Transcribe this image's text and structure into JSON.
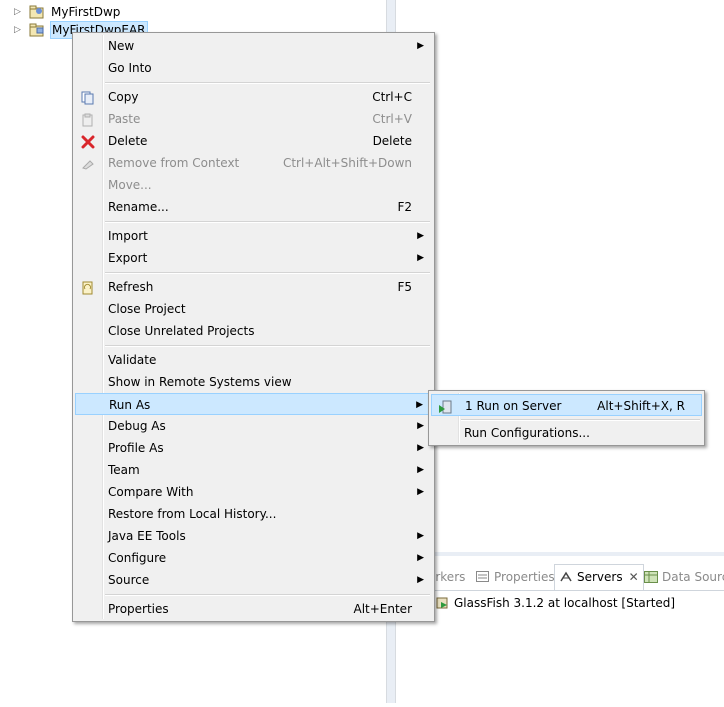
{
  "explorer": {
    "projects": [
      {
        "label": "MyFirstDwp",
        "selected": false
      },
      {
        "label": "MyFirstDwpEAR",
        "selected": true
      }
    ]
  },
  "context_menu": {
    "items": [
      {
        "label": "New",
        "accel": "",
        "submenu": true
      },
      {
        "label": "Go Into",
        "accel": ""
      },
      {
        "label": "Copy",
        "accel": "Ctrl+C",
        "icon": "copy-icon"
      },
      {
        "label": "Paste",
        "accel": "Ctrl+V",
        "icon": "paste-icon",
        "disabled": true
      },
      {
        "label": "Delete",
        "accel": "Delete",
        "icon": "delete-icon"
      },
      {
        "label": "Remove from Context",
        "accel": "Ctrl+Alt+Shift+Down",
        "icon": "remove-context-icon",
        "disabled": true
      },
      {
        "label": "Move...",
        "accel": "",
        "disabled": true
      },
      {
        "label": "Rename...",
        "accel": "F2"
      },
      {
        "label": "Import",
        "accel": "",
        "submenu": true
      },
      {
        "label": "Export",
        "accel": "",
        "submenu": true
      },
      {
        "label": "Refresh",
        "accel": "F5",
        "icon": "refresh-icon"
      },
      {
        "label": "Close Project",
        "accel": ""
      },
      {
        "label": "Close Unrelated Projects",
        "accel": ""
      },
      {
        "label": "Validate",
        "accel": ""
      },
      {
        "label": "Show in Remote Systems view",
        "accel": ""
      },
      {
        "label": "Run As",
        "accel": "",
        "submenu": true,
        "highlighted": true
      },
      {
        "label": "Debug As",
        "accel": "",
        "submenu": true
      },
      {
        "label": "Profile As",
        "accel": "",
        "submenu": true
      },
      {
        "label": "Team",
        "accel": "",
        "submenu": true
      },
      {
        "label": "Compare With",
        "accel": "",
        "submenu": true
      },
      {
        "label": "Restore from Local History...",
        "accel": ""
      },
      {
        "label": "Java EE Tools",
        "accel": "",
        "submenu": true
      },
      {
        "label": "Configure",
        "accel": "",
        "submenu": true
      },
      {
        "label": "Source",
        "accel": "",
        "submenu": true
      },
      {
        "label": "Properties",
        "accel": "Alt+Enter"
      }
    ]
  },
  "run_as_submenu": {
    "items": [
      {
        "label": "1 Run on Server",
        "accel": "Alt+Shift+X, R",
        "icon": "run-on-server-icon",
        "highlighted": true
      },
      {
        "label": "Run Configurations...",
        "accel": ""
      }
    ]
  },
  "bottom_panel": {
    "tabs": [
      {
        "label": "arkers"
      },
      {
        "label": "Properties"
      },
      {
        "label": "Servers",
        "active": true
      },
      {
        "label": "Data Source"
      }
    ],
    "server_entry": "GlassFish 3.1.2 at localhost  [Started]"
  },
  "colors": {
    "menu_bg": "#f0f0f0",
    "hover_bg": "#cce8ff",
    "hover_border": "#99d1ff",
    "disabled_text": "#8d8d8d",
    "delete_red": "#d9262b"
  }
}
